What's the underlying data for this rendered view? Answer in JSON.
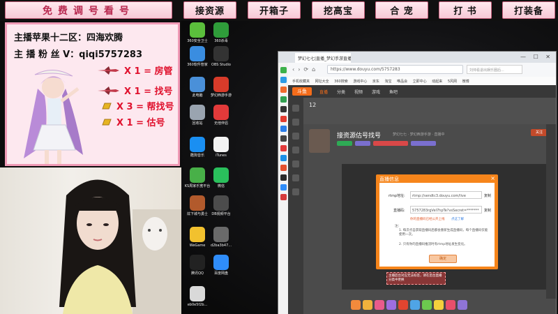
{
  "topbar": {
    "buttons": [
      {
        "label": "免费调号看号",
        "style": "wide"
      },
      {
        "label": "接资源",
        "style": "dark"
      },
      {
        "label": "开箱子",
        "style": "dark"
      },
      {
        "label": "挖高宝",
        "style": "dark"
      },
      {
        "label": "合  宠",
        "style": "dark"
      },
      {
        "label": "打  书",
        "style": "dark"
      },
      {
        "label": "打装备",
        "style": "dark"
      }
    ]
  },
  "info_panel": {
    "server_line": "主播苹果十二区：四海欢腾",
    "fan_line": "主 播 粉 丝 V：qiqi5757283",
    "gifts": [
      {
        "icon": "plane-icon",
        "text": "X 1 = 房管"
      },
      {
        "icon": "plane-icon",
        "text": "X 1 = 找号"
      },
      {
        "icon": "gold-bar-icon",
        "text": "X 3 = 帮找号"
      },
      {
        "icon": "gold-bar-icon",
        "text": "X 1 = 估号"
      }
    ]
  },
  "desktop": {
    "icons": [
      {
        "label": "360安全卫士",
        "color": "#5bbf3c"
      },
      {
        "label": "360杀毒",
        "color": "#2f9d3a"
      },
      {
        "label": "360软件管家",
        "color": "#3a8de0"
      },
      {
        "label": "OBS Studio",
        "color": "#333333"
      },
      {
        "label": "此电脑",
        "color": "#4a90d9"
      },
      {
        "label": "梦幻西游手游",
        "color": "#d83b2a"
      },
      {
        "label": "回收站",
        "color": "#9aa4b0"
      },
      {
        "label": "无他伴侣",
        "color": "#e23a3a"
      },
      {
        "label": "酷狗音乐",
        "color": "#1a8ff2"
      },
      {
        "label": "iTunes",
        "color": "#f3f3f3"
      },
      {
        "label": "KS周家乐宽平台",
        "color": "#48b048"
      },
      {
        "label": "微信",
        "color": "#2ac05c"
      },
      {
        "label": "炫下城与勇士",
        "color": "#b25a2c"
      },
      {
        "label": "DB视频平台",
        "color": "#4c4c4c"
      },
      {
        "label": "WeGame",
        "color": "#f2c12e"
      },
      {
        "label": "d2ba3b47...",
        "color": "#6a6a6a"
      },
      {
        "label": "腾讯QQ",
        "color": "#222222"
      },
      {
        "label": "百度网盘",
        "color": "#2f8dfa"
      },
      {
        "label": "eb0e5f2b...",
        "color": "#d9d9d9"
      }
    ]
  },
  "browser": {
    "tab_title": "梦幻七七|直播_梦幻手游直播_斗...",
    "window_controls": "— ☐ ✕",
    "url": "https://www.douyu.com/5757283",
    "search_placeholder": "刘帅看退出娱乐圈后...",
    "bookmarks": "手机收藏夹  网址大全  360搜索  游戏中心  京东  淘宝  唯品会  立即中心  动起来  5风网  微博",
    "site": {
      "logo": "斗鱼",
      "nav": [
        "直播",
        "分类",
        "视频",
        "游戏",
        "鱼吧"
      ],
      "room_title": "接资源估号找号",
      "room_meta": "梦幻七七 · 梦幻西游手游 · 直播中",
      "follow": "关注",
      "stat_number": "12"
    }
  },
  "modal": {
    "title": "直播信息",
    "close": "×",
    "rtmp_label": "rtmp地址:",
    "rtmp_value": "rtmp://sendtc3.douyu.com/live",
    "code_label": "直播码:",
    "code_value": "5757283rgVeI7hpTe?vsSecret=*******",
    "copy": "复制",
    "warning": "你的直播码已经公开上线",
    "link": "点这了解",
    "note_title": "注：",
    "notes": [
      "1. 每次点击获取直播码后都会重新生成直播码，每个直播码仅能使用一次。",
      "2. 只有你的直播码推流时有rtmp地址发生变化。"
    ],
    "confirm": "确定"
  },
  "tooltip": "主播后台对应无法标签，请在后台直播分类中更换"
}
